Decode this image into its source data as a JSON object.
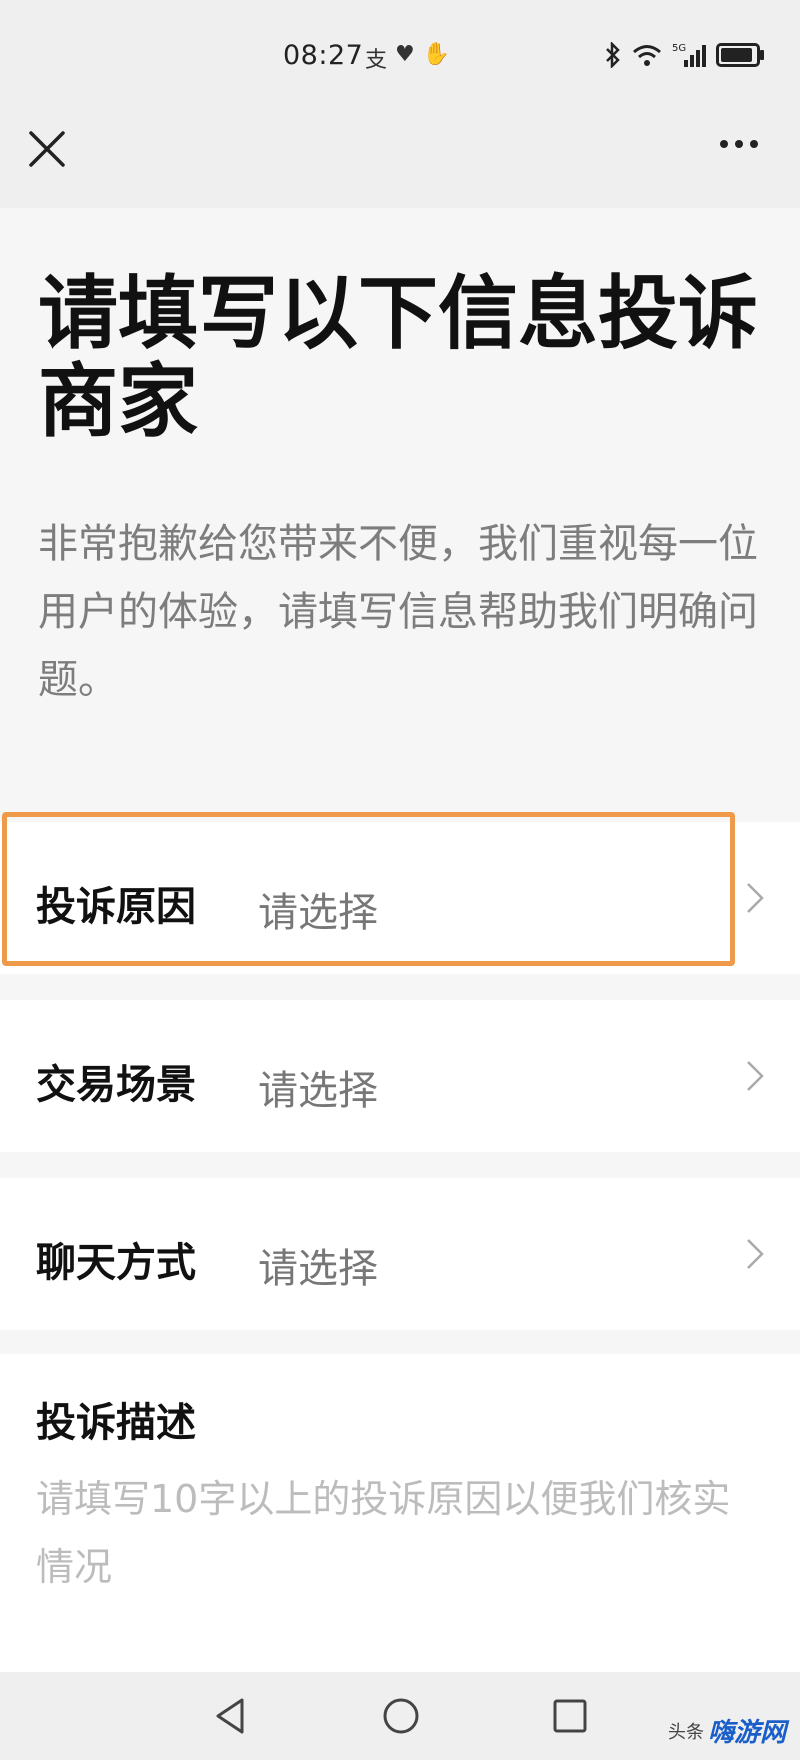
{
  "status": {
    "time": "08:27",
    "left_icons": [
      "alipay-icon",
      "heart-icon",
      "hand-icon"
    ],
    "network": "5G",
    "battery_level": 0.9
  },
  "nav": {
    "close_icon": "close-icon",
    "more_icon": "more-icon"
  },
  "page": {
    "title": "请填写以下信息投诉商家",
    "subtitle": "非常抱歉给您带来不便，我们重视每一位用户的体验，请填写信息帮助我们明确问题。"
  },
  "form": {
    "rows": [
      {
        "label": "投诉原因",
        "value": "请选择"
      },
      {
        "label": "交易场景",
        "value": "请选择"
      },
      {
        "label": "聊天方式",
        "value": "请选择"
      }
    ],
    "description": {
      "label": "投诉描述",
      "placeholder": "请填写10字以上的投诉原因以便我们核实情况"
    }
  },
  "highlight_color": "#ee9a4a",
  "watermark": {
    "prefix": "头条",
    "brand": "嗨游网"
  }
}
